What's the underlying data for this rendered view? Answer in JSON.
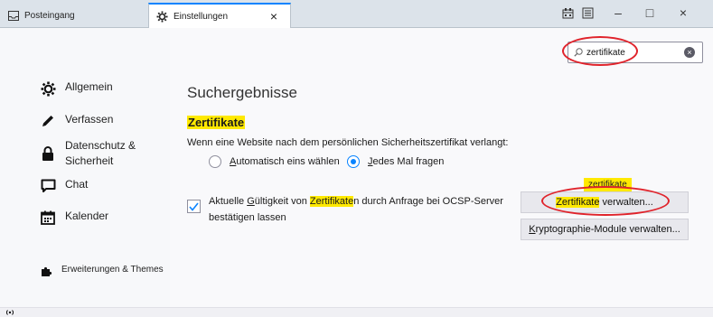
{
  "tabs": [
    {
      "label": "Posteingang",
      "icon": "inbox-icon"
    },
    {
      "label": "Einstellungen",
      "icon": "gear-icon"
    }
  ],
  "tab_close": "×",
  "window_controls": {
    "minimize": "–",
    "maximize": "□",
    "close": "×"
  },
  "sidebar": {
    "items": [
      {
        "label": "Allgemein",
        "icon": "gear-icon"
      },
      {
        "label": "Verfassen",
        "icon": "pencil-icon"
      },
      {
        "label": "Datenschutz &\nSicherheit",
        "icon": "lock-icon"
      },
      {
        "label": "Chat",
        "icon": "chat-icon"
      },
      {
        "label": "Kalender",
        "icon": "calendar-icon"
      }
    ],
    "footer": {
      "label": "Erweiterungen & Themes",
      "icon": "puzzle-icon"
    }
  },
  "search": {
    "value": "zertifikate"
  },
  "main": {
    "title": "Suchergebnisse",
    "section_title": "Zertifikate",
    "description": "Wenn eine Website nach dem persönlichen Sicherheitszertifikat verlangt:",
    "radio_auto": {
      "underline": "A",
      "rest": "utomatisch eins wählen"
    },
    "radio_ask": {
      "underline": "J",
      "rest": "edes Mal fragen"
    },
    "checkbox": {
      "prefix": "Aktuelle ",
      "underline": "G",
      "mid": "ültigkeit von ",
      "highlight": "Zertifikate",
      "suffix": "n durch Anfrage bei OCSP-Server bestätigen lassen"
    },
    "tooltip": "zertifikate",
    "manage_button": {
      "highlight": "Zertifikate",
      "rest": " verwalten..."
    },
    "crypto_button": {
      "underline": "K",
      "rest": "ryptographie-Module verwalten..."
    }
  },
  "colors": {
    "accent": "#0a84ff",
    "highlight": "#ffe900",
    "annotation": "#e0232b"
  }
}
